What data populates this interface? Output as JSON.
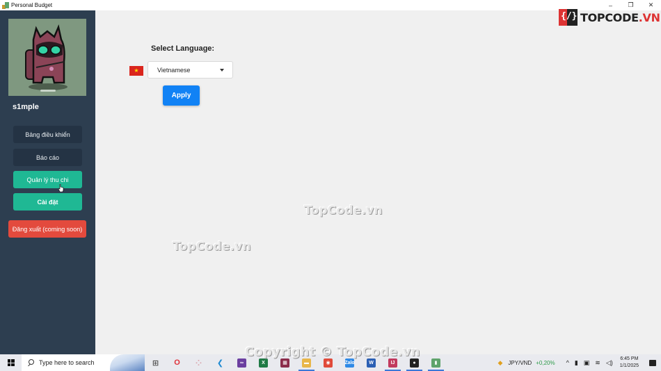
{
  "window": {
    "title": "Personal Budget",
    "controls": {
      "minimize": "–",
      "restore": "❐",
      "close": "✕"
    }
  },
  "brand_logo": {
    "mark": "{/}",
    "text_main": "TOPCODE",
    "text_suffix": ".VN"
  },
  "sidebar": {
    "username": "s1mple",
    "avatar_alt": "avatar-image",
    "items": [
      {
        "label": "Bảng điều khiển",
        "style": "dark"
      },
      {
        "label": "Báo cáo",
        "style": "dark"
      },
      {
        "label": "Quản lý thu chi",
        "style": "teal"
      },
      {
        "label": "Cài đặt",
        "style": "teal-bold",
        "active": true
      },
      {
        "label": "Đăng xuất (coming soon)",
        "style": "red"
      }
    ]
  },
  "settings": {
    "select_language_label": "Select Language:",
    "flag": "★",
    "language_selected": "Vietnamese",
    "apply_label": "Apply"
  },
  "watermarks": [
    "TopCode.vn",
    "TopCode.vn",
    "Copyright © TopCode.vn"
  ],
  "taskbar": {
    "search_placeholder": "Type here to search",
    "apps": [
      {
        "name": "task-view",
        "glyph": "⊞",
        "color": "#555555"
      },
      {
        "name": "opera",
        "glyph": "O",
        "color": "#e0323a"
      },
      {
        "name": "app-generic",
        "glyph": "⁘",
        "color": "#d9a0a8"
      },
      {
        "name": "vscode",
        "glyph": "❮",
        "color": "#1f8ad2"
      },
      {
        "name": "visual-studio",
        "glyph": "∞",
        "color": "#6b3fa0"
      },
      {
        "name": "excel",
        "glyph": "X",
        "color": "#1f7a45"
      },
      {
        "name": "winrar",
        "glyph": "▦",
        "color": "#8b2c4a"
      },
      {
        "name": "file-explorer",
        "glyph": "▬",
        "color": "#e8b64a"
      },
      {
        "name": "chrome",
        "glyph": "◉",
        "color": "#e04a3a"
      },
      {
        "name": "zalo",
        "glyph": "Zalo",
        "color": "#2f8ae6"
      },
      {
        "name": "word",
        "glyph": "W",
        "color": "#2b5fb4"
      },
      {
        "name": "intellij",
        "glyph": "IJ",
        "color": "#c23a5e"
      },
      {
        "name": "media-app",
        "glyph": "●",
        "color": "#222222"
      },
      {
        "name": "personal-budget",
        "glyph": "▮",
        "color": "#5fa36b"
      }
    ],
    "tray": {
      "currency_pair": "JPY/VND",
      "currency_change": "+0,20%",
      "time": "6:45 PM",
      "date": "1/1/2025"
    }
  }
}
